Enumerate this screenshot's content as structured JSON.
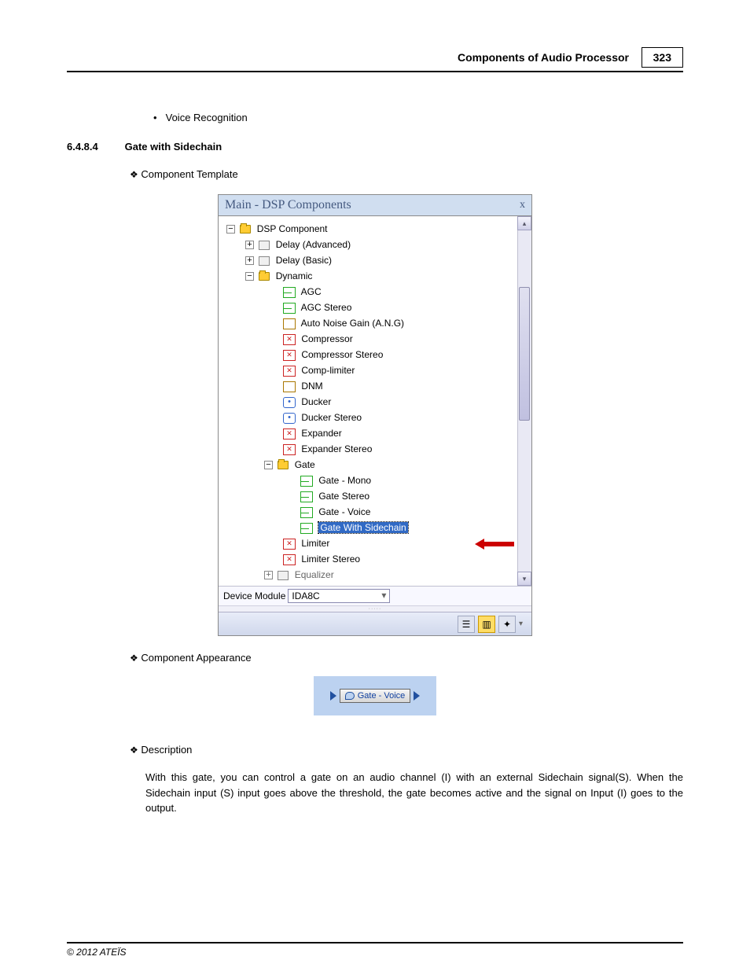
{
  "header": {
    "title": "Components of Audio Processor",
    "page_number": "323"
  },
  "bullet_item": "Voice Recognition",
  "section": {
    "number": "6.4.8.4",
    "title": "Gate with Sidechain"
  },
  "sub_template": "Component Template",
  "sub_appearance": "Component Appearance",
  "sub_description": "Description",
  "panel": {
    "title": "Main - DSP Components",
    "close_glyph": "x",
    "scroll_up": "▴",
    "scroll_down": "▾",
    "tree": {
      "root": "DSP Component",
      "delay_advanced": "Delay (Advanced)",
      "delay_basic": "Delay (Basic)",
      "dynamic": "Dynamic",
      "agc": "AGC",
      "agc_stereo": "AGC Stereo",
      "ang": "Auto Noise Gain (A.N.G)",
      "compressor": "Compressor",
      "compressor_stereo": "Compressor Stereo",
      "comp_limiter": "Comp-limiter",
      "dnm": "DNM",
      "ducker": "Ducker",
      "ducker_stereo": "Ducker Stereo",
      "expander": "Expander",
      "expander_stereo": "Expander Stereo",
      "gate": "Gate",
      "gate_mono": "Gate - Mono",
      "gate_stereo": "Gate Stereo",
      "gate_voice": "Gate - Voice",
      "gate_sidechain": "Gate With Sidechain",
      "limiter": "Limiter",
      "limiter_stereo": "Limiter Stereo",
      "equalizer_cut": "Equalizer"
    },
    "device_label": "Device Module",
    "device_value": "IDA8C"
  },
  "appearance_chip": "Gate - Voice",
  "description_text": "With this gate, you can control a gate on an audio channel (I) with an external Sidechain signal(S). When the Sidechain input (S) input goes above the threshold, the gate becomes active and the signal on Input (I) goes to the output.",
  "footer": "© 2012 ATEÏS"
}
